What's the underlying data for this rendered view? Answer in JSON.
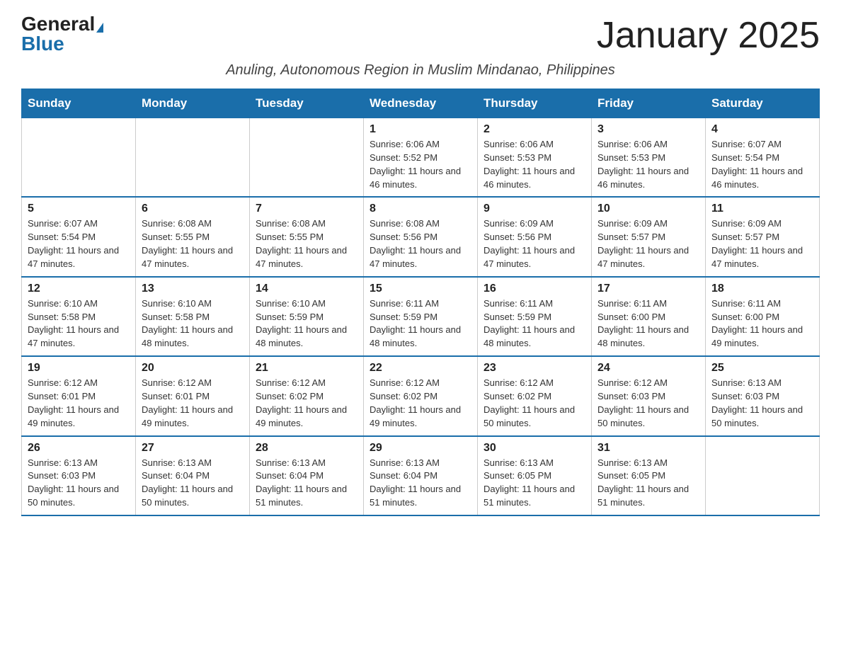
{
  "header": {
    "logo_general": "General",
    "logo_blue": "Blue",
    "month_title": "January 2025",
    "subtitle": "Anuling, Autonomous Region in Muslim Mindanao, Philippines"
  },
  "days_of_week": [
    "Sunday",
    "Monday",
    "Tuesday",
    "Wednesday",
    "Thursday",
    "Friday",
    "Saturday"
  ],
  "weeks": [
    [
      {
        "day": "",
        "info": ""
      },
      {
        "day": "",
        "info": ""
      },
      {
        "day": "",
        "info": ""
      },
      {
        "day": "1",
        "info": "Sunrise: 6:06 AM\nSunset: 5:52 PM\nDaylight: 11 hours and 46 minutes."
      },
      {
        "day": "2",
        "info": "Sunrise: 6:06 AM\nSunset: 5:53 PM\nDaylight: 11 hours and 46 minutes."
      },
      {
        "day": "3",
        "info": "Sunrise: 6:06 AM\nSunset: 5:53 PM\nDaylight: 11 hours and 46 minutes."
      },
      {
        "day": "4",
        "info": "Sunrise: 6:07 AM\nSunset: 5:54 PM\nDaylight: 11 hours and 46 minutes."
      }
    ],
    [
      {
        "day": "5",
        "info": "Sunrise: 6:07 AM\nSunset: 5:54 PM\nDaylight: 11 hours and 47 minutes."
      },
      {
        "day": "6",
        "info": "Sunrise: 6:08 AM\nSunset: 5:55 PM\nDaylight: 11 hours and 47 minutes."
      },
      {
        "day": "7",
        "info": "Sunrise: 6:08 AM\nSunset: 5:55 PM\nDaylight: 11 hours and 47 minutes."
      },
      {
        "day": "8",
        "info": "Sunrise: 6:08 AM\nSunset: 5:56 PM\nDaylight: 11 hours and 47 minutes."
      },
      {
        "day": "9",
        "info": "Sunrise: 6:09 AM\nSunset: 5:56 PM\nDaylight: 11 hours and 47 minutes."
      },
      {
        "day": "10",
        "info": "Sunrise: 6:09 AM\nSunset: 5:57 PM\nDaylight: 11 hours and 47 minutes."
      },
      {
        "day": "11",
        "info": "Sunrise: 6:09 AM\nSunset: 5:57 PM\nDaylight: 11 hours and 47 minutes."
      }
    ],
    [
      {
        "day": "12",
        "info": "Sunrise: 6:10 AM\nSunset: 5:58 PM\nDaylight: 11 hours and 47 minutes."
      },
      {
        "day": "13",
        "info": "Sunrise: 6:10 AM\nSunset: 5:58 PM\nDaylight: 11 hours and 48 minutes."
      },
      {
        "day": "14",
        "info": "Sunrise: 6:10 AM\nSunset: 5:59 PM\nDaylight: 11 hours and 48 minutes."
      },
      {
        "day": "15",
        "info": "Sunrise: 6:11 AM\nSunset: 5:59 PM\nDaylight: 11 hours and 48 minutes."
      },
      {
        "day": "16",
        "info": "Sunrise: 6:11 AM\nSunset: 5:59 PM\nDaylight: 11 hours and 48 minutes."
      },
      {
        "day": "17",
        "info": "Sunrise: 6:11 AM\nSunset: 6:00 PM\nDaylight: 11 hours and 48 minutes."
      },
      {
        "day": "18",
        "info": "Sunrise: 6:11 AM\nSunset: 6:00 PM\nDaylight: 11 hours and 49 minutes."
      }
    ],
    [
      {
        "day": "19",
        "info": "Sunrise: 6:12 AM\nSunset: 6:01 PM\nDaylight: 11 hours and 49 minutes."
      },
      {
        "day": "20",
        "info": "Sunrise: 6:12 AM\nSunset: 6:01 PM\nDaylight: 11 hours and 49 minutes."
      },
      {
        "day": "21",
        "info": "Sunrise: 6:12 AM\nSunset: 6:02 PM\nDaylight: 11 hours and 49 minutes."
      },
      {
        "day": "22",
        "info": "Sunrise: 6:12 AM\nSunset: 6:02 PM\nDaylight: 11 hours and 49 minutes."
      },
      {
        "day": "23",
        "info": "Sunrise: 6:12 AM\nSunset: 6:02 PM\nDaylight: 11 hours and 50 minutes."
      },
      {
        "day": "24",
        "info": "Sunrise: 6:12 AM\nSunset: 6:03 PM\nDaylight: 11 hours and 50 minutes."
      },
      {
        "day": "25",
        "info": "Sunrise: 6:13 AM\nSunset: 6:03 PM\nDaylight: 11 hours and 50 minutes."
      }
    ],
    [
      {
        "day": "26",
        "info": "Sunrise: 6:13 AM\nSunset: 6:03 PM\nDaylight: 11 hours and 50 minutes."
      },
      {
        "day": "27",
        "info": "Sunrise: 6:13 AM\nSunset: 6:04 PM\nDaylight: 11 hours and 50 minutes."
      },
      {
        "day": "28",
        "info": "Sunrise: 6:13 AM\nSunset: 6:04 PM\nDaylight: 11 hours and 51 minutes."
      },
      {
        "day": "29",
        "info": "Sunrise: 6:13 AM\nSunset: 6:04 PM\nDaylight: 11 hours and 51 minutes."
      },
      {
        "day": "30",
        "info": "Sunrise: 6:13 AM\nSunset: 6:05 PM\nDaylight: 11 hours and 51 minutes."
      },
      {
        "day": "31",
        "info": "Sunrise: 6:13 AM\nSunset: 6:05 PM\nDaylight: 11 hours and 51 minutes."
      },
      {
        "day": "",
        "info": ""
      }
    ]
  ]
}
